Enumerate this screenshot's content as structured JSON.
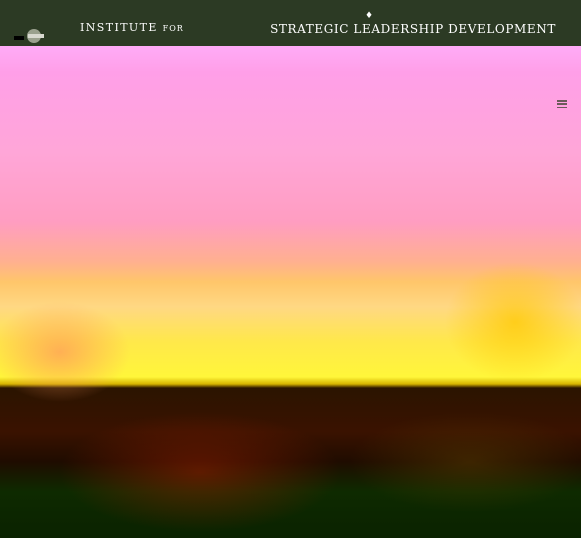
{
  "header": {
    "org_name_line1": "INSTITUTE",
    "org_name_for": "FOR",
    "org_name_line2": "",
    "program_title": "STRATEGIC LEADERSHIP DEVELOPMENT"
  },
  "colors": {
    "header_bg": "#2c3a24",
    "text": "#ffffff"
  },
  "icons": {
    "logo": "institute-logo",
    "menu": "hamburger-menu-icon"
  }
}
